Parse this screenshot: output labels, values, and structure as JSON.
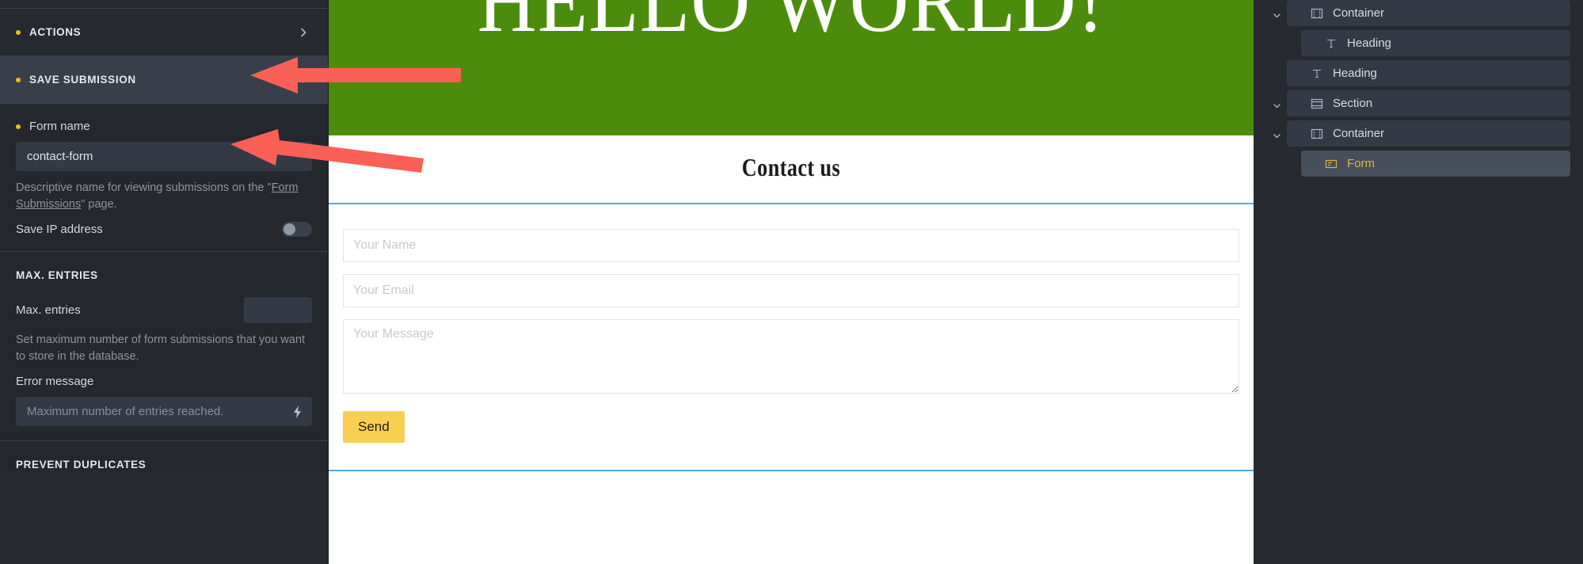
{
  "left_panel": {
    "sections": [
      {
        "id": "actions",
        "title": "ACTIONS",
        "state": "collapsed",
        "chevron": "chevron-right-icon"
      },
      {
        "id": "save_submission",
        "title": "SAVE SUBMISSION",
        "state": "expanded",
        "chevron": "chevron-down-icon"
      }
    ],
    "save_submission": {
      "form_name_label": "Form name",
      "form_name_value": "contact-form",
      "form_name_placeholder": "",
      "help_prefix": "Descriptive name for viewing submissions on the \"",
      "help_link": "Form Submissions",
      "help_suffix": "\" page.",
      "save_ip_label": "Save IP address",
      "save_ip_state": "off"
    },
    "max_entries": {
      "heading": "MAX. ENTRIES",
      "field_label": "Max. entries",
      "field_value": "",
      "help": "Set maximum number of form submissions that you want to store in the database.",
      "error_label": "Error message",
      "error_placeholder": "Maximum number of entries reached.",
      "error_value": "",
      "dynamic_icon": "lightning-bolt-icon"
    },
    "prevent_duplicates": {
      "heading": "PREVENT DUPLICATES"
    }
  },
  "canvas": {
    "hero": {
      "heading": "HELLO WORLD!",
      "background_color": "#4c8c0c"
    },
    "contact": {
      "title": "Contact us",
      "selection_color": "#55a7e8",
      "fields": [
        {
          "name": "name",
          "placeholder": "Your Name",
          "value": "",
          "type": "text"
        },
        {
          "name": "email",
          "placeholder": "Your Email",
          "value": "",
          "type": "text"
        },
        {
          "name": "message",
          "placeholder": "Your Message",
          "value": "",
          "type": "textarea"
        }
      ],
      "submit_label": "Send",
      "submit_color": "#f9cf52"
    }
  },
  "right_panel": {
    "accent_color": "#e0b33c",
    "layers": [
      {
        "label": "Container",
        "icon": "container-icon",
        "indent": 1,
        "chevron": "chevron-down-icon",
        "selected": false
      },
      {
        "label": "Heading",
        "icon": "text-type-icon",
        "indent": 2,
        "chevron": "",
        "selected": false
      },
      {
        "label": "Heading",
        "icon": "text-type-icon",
        "indent": 0,
        "chevron": "",
        "selected": false
      },
      {
        "label": "Section",
        "icon": "section-icon",
        "indent": 0,
        "chevron": "chevron-down-icon",
        "selected": false
      },
      {
        "label": "Container",
        "icon": "container-icon",
        "indent": 1,
        "chevron": "chevron-down-icon",
        "selected": false
      },
      {
        "label": "Form",
        "icon": "form-icon",
        "indent": 2,
        "chevron": "",
        "selected": true
      }
    ]
  },
  "annotations": {
    "color": "#fa6055",
    "arrows": [
      {
        "id": "arrow-save-submission",
        "points_to": "save-submission-section-header"
      },
      {
        "id": "arrow-form-name",
        "points_to": "form-name-input"
      }
    ]
  }
}
